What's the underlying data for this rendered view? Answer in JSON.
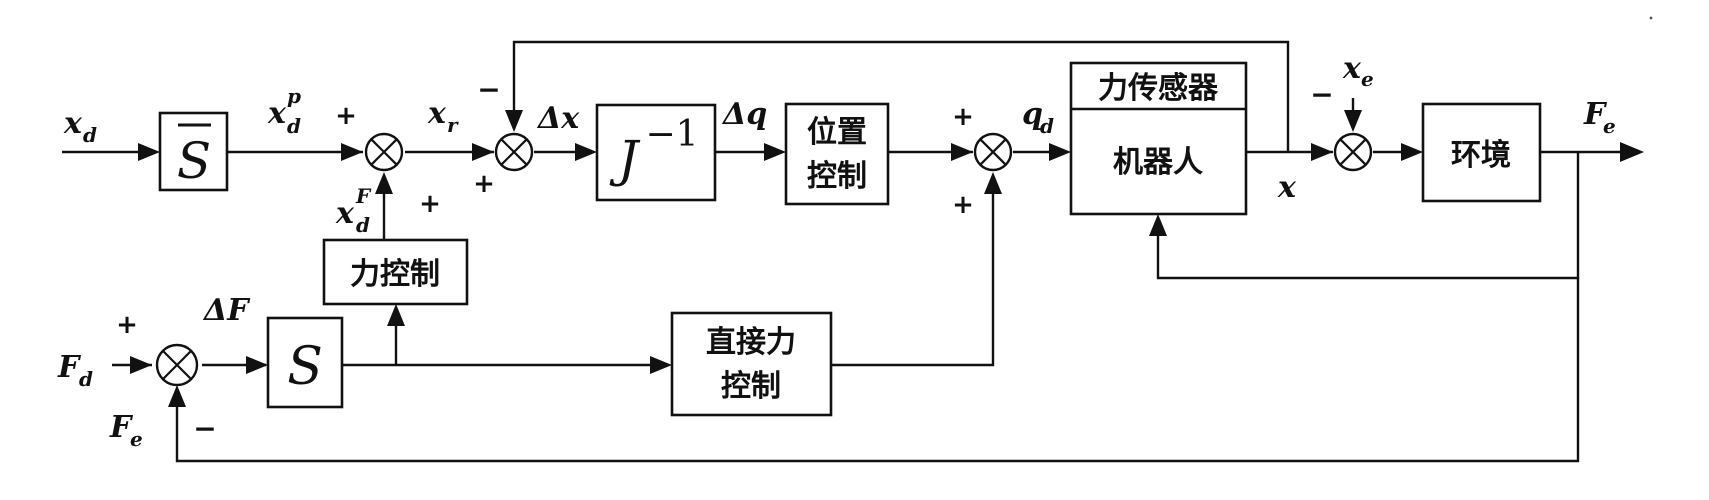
{
  "blocks": {
    "s_bar": "S",
    "jacobian_base": "J",
    "jacobian_exp": "−1",
    "position_control_l1": "位置",
    "position_control_l2": "控制",
    "force_sensor": "力传感器",
    "robot": "机器人",
    "environment": "环境",
    "force_control": "力控制",
    "s_block": "S",
    "direct_force_l1": "直接力",
    "direct_force_l2": "控制"
  },
  "signals": {
    "xd": "x",
    "xd_sub": "d",
    "xdp": "x",
    "xdp_sub": "d",
    "xdp_sup": "p",
    "xr": "x",
    "xr_sub": "r",
    "dx": "Δx",
    "dq": "Δq",
    "qd": "q",
    "qd_sub": "d",
    "x_out": "x",
    "xe": "x",
    "xe_sub": "e",
    "fe_out": "F",
    "fe_out_sub": "e",
    "xdf": "x",
    "xdf_sub": "d",
    "xdf_sup": "F",
    "fd": "F",
    "fd_sub": "d",
    "dF": "ΔF",
    "fe_fb": "F",
    "fe_fb_sub": "e"
  },
  "signs": {
    "plus": "+",
    "minus": "−"
  }
}
